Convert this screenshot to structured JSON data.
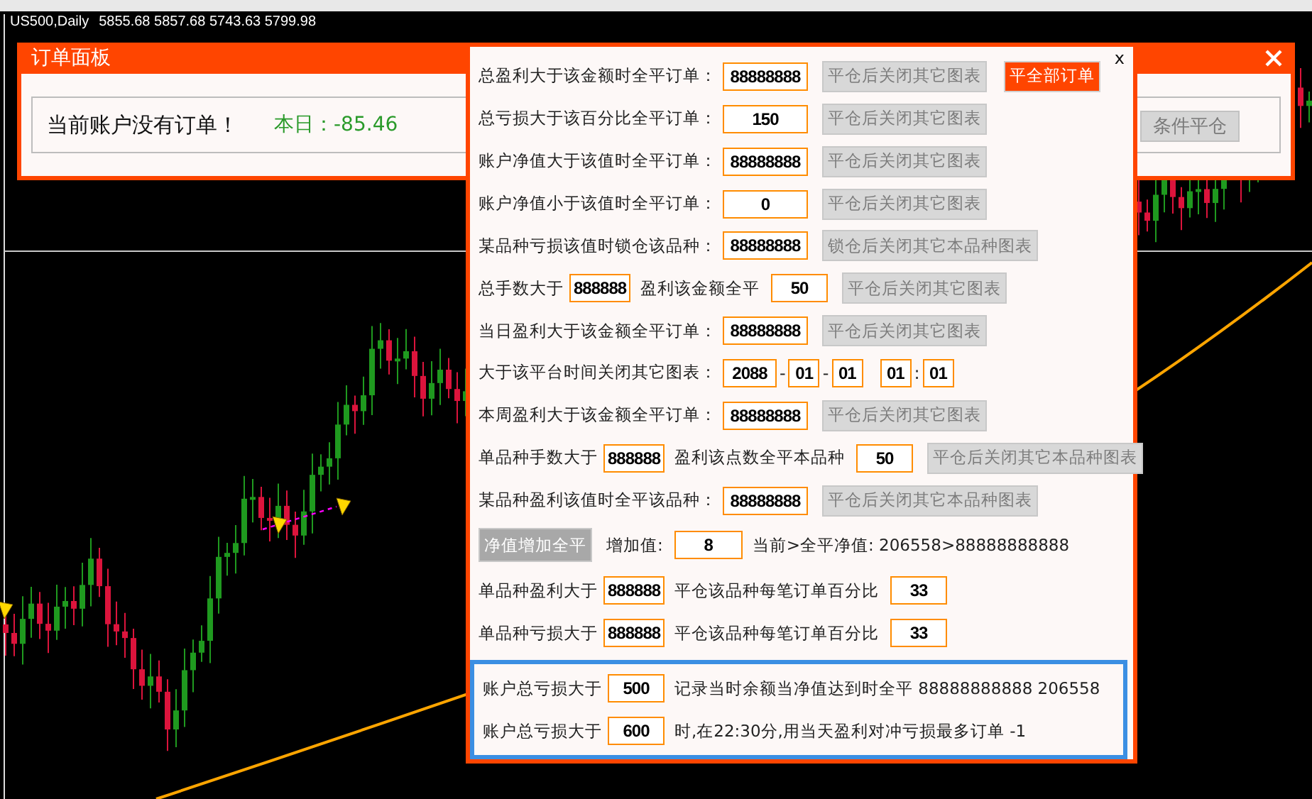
{
  "chart": {
    "symbol": "US500,Daily",
    "prices": "5855.68 5857.68 5743.63 5799.98"
  },
  "order_panel": {
    "title": "订单面板",
    "message": "当前账户没有订单！",
    "today_label": "本日：",
    "today_value": "-85.46",
    "button": {
      "label": "条件平仓",
      "disabled": true
    }
  },
  "dialog": {
    "close": "x",
    "rows": [
      {
        "items": [
          {
            "kind": "text",
            "text": "总盈利大于该金额时全平订单："
          },
          {
            "kind": "field",
            "value": "88888888"
          },
          {
            "kind": "button",
            "label": "平仓后关闭其它图表",
            "disabled": true
          },
          {
            "kind": "button",
            "label": "平全部订单",
            "disabled": false
          }
        ]
      },
      {
        "items": [
          {
            "kind": "text",
            "text": "总亏损大于该百分比全平订单："
          },
          {
            "kind": "field",
            "value": "150"
          },
          {
            "kind": "button",
            "label": "平仓后关闭其它图表",
            "disabled": true
          }
        ]
      },
      {
        "items": [
          {
            "kind": "text",
            "text": "账户净值大于该值时全平订单："
          },
          {
            "kind": "field",
            "value": "88888888"
          },
          {
            "kind": "button",
            "label": "平仓后关闭其它图表",
            "disabled": true
          }
        ]
      },
      {
        "items": [
          {
            "kind": "text",
            "text": "账户净值小于该值时全平订单："
          },
          {
            "kind": "field",
            "value": "0"
          },
          {
            "kind": "button",
            "label": "平仓后关闭其它图表",
            "disabled": true
          }
        ]
      },
      {
        "items": [
          {
            "kind": "text",
            "text": "某品种亏损该值时锁仓该品种："
          },
          {
            "kind": "field",
            "value": "88888888"
          },
          {
            "kind": "button",
            "label": "锁仓后关闭其它本品种图表",
            "disabled": true
          }
        ]
      },
      {
        "items": [
          {
            "kind": "text",
            "text": "总手数大于"
          },
          {
            "kind": "field",
            "value": "888888"
          },
          {
            "kind": "text",
            "text": "盈利该金额全平"
          },
          {
            "kind": "field",
            "value": "50"
          },
          {
            "kind": "button",
            "label": "平仓后关闭其它图表",
            "disabled": true
          }
        ]
      },
      {
        "items": [
          {
            "kind": "text",
            "text": "当日盈利大于该金额全平订单："
          },
          {
            "kind": "field",
            "value": "88888888"
          },
          {
            "kind": "button",
            "label": "平仓后关闭其它图表",
            "disabled": true
          }
        ]
      },
      {
        "items": [
          {
            "kind": "text",
            "text": "大于该平台时间关闭其它图表："
          },
          {
            "kind": "field",
            "value": "2088"
          },
          {
            "kind": "sep",
            "text": "-"
          },
          {
            "kind": "field",
            "value": "01"
          },
          {
            "kind": "sep",
            "text": "-"
          },
          {
            "kind": "field",
            "value": "01"
          },
          {
            "kind": "gap"
          },
          {
            "kind": "field",
            "value": "01"
          },
          {
            "kind": "sep",
            "text": ":"
          },
          {
            "kind": "field",
            "value": "01"
          }
        ]
      },
      {
        "items": [
          {
            "kind": "text",
            "text": "本周盈利大于该金额全平订单："
          },
          {
            "kind": "field",
            "value": "88888888"
          },
          {
            "kind": "button",
            "label": "平仓后关闭其它图表",
            "disabled": true
          }
        ]
      },
      {
        "items": [
          {
            "kind": "text",
            "text": "单品种手数大于"
          },
          {
            "kind": "field",
            "value": "888888"
          },
          {
            "kind": "text",
            "text": "盈利该点数全平本品种"
          },
          {
            "kind": "field",
            "value": "50"
          },
          {
            "kind": "button",
            "label": "平仓后关闭其它本品种图表",
            "disabled": true
          }
        ]
      },
      {
        "items": [
          {
            "kind": "text",
            "text": "某品种盈利该值时全平该品种："
          },
          {
            "kind": "field",
            "value": "88888888"
          },
          {
            "kind": "button",
            "label": "平仓后关闭其它本品种图表",
            "disabled": true
          }
        ]
      },
      {
        "items": [
          {
            "kind": "button",
            "label": "净值增加全平",
            "disabled": true
          },
          {
            "kind": "text",
            "text": "增加值:"
          },
          {
            "kind": "field",
            "value": "8"
          },
          {
            "kind": "text",
            "text": "当前>全平净值: 206558>88888888888"
          }
        ]
      },
      {
        "items": [
          {
            "kind": "text",
            "text": "单品种盈利大于"
          },
          {
            "kind": "field",
            "value": "888888"
          },
          {
            "kind": "text",
            "text": "平仓该品种每笔订单百分比"
          },
          {
            "kind": "field",
            "value": "33"
          }
        ]
      },
      {
        "items": [
          {
            "kind": "text",
            "text": "单品种亏损大于"
          },
          {
            "kind": "field",
            "value": "888888"
          },
          {
            "kind": "text",
            "text": "平仓该品种每笔订单百分比"
          },
          {
            "kind": "field",
            "value": "33"
          }
        ]
      }
    ],
    "framed_rows": [
      {
        "items": [
          {
            "kind": "text",
            "text": "账户总亏损大于"
          },
          {
            "kind": "field",
            "value": "500"
          },
          {
            "kind": "text",
            "text": "记录当时余额当净值达到时全平 88888888888 206558"
          }
        ]
      },
      {
        "items": [
          {
            "kind": "text",
            "text": "账户总亏损大于"
          },
          {
            "kind": "field",
            "value": "600"
          },
          {
            "kind": "text",
            "text": "时,在22:30分,用当天盈利对冲亏损最多订单 -1"
          }
        ]
      }
    ]
  }
}
